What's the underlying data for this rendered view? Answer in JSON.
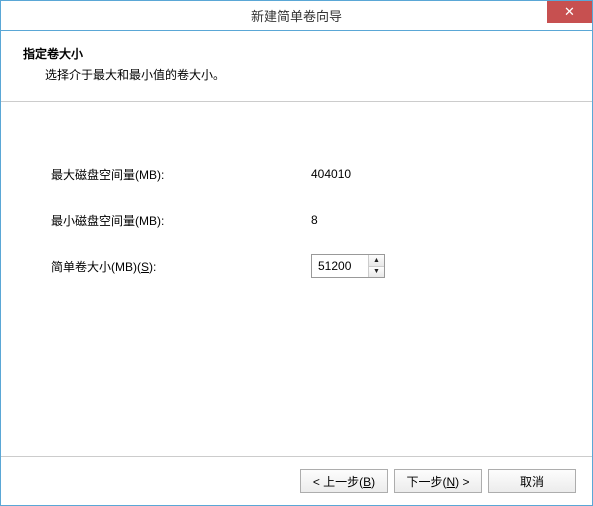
{
  "titlebar": {
    "title": "新建简单卷向导",
    "close_glyph": "✕"
  },
  "header": {
    "title": "指定卷大小",
    "subtitle": "选择介于最大和最小值的卷大小。"
  },
  "fields": {
    "max_label": "最大磁盘空间量(MB):",
    "max_value": "404010",
    "min_label": "最小磁盘空间量(MB):",
    "min_value": "8",
    "size_label_prefix": "简单卷大小(MB)(",
    "size_label_hotkey": "S",
    "size_label_suffix": "):",
    "size_value": "51200"
  },
  "footer": {
    "back_prefix": "< 上一步(",
    "back_hotkey": "B",
    "back_suffix": ")",
    "next_prefix": "下一步(",
    "next_hotkey": "N",
    "next_suffix": ") >",
    "cancel": "取消"
  }
}
